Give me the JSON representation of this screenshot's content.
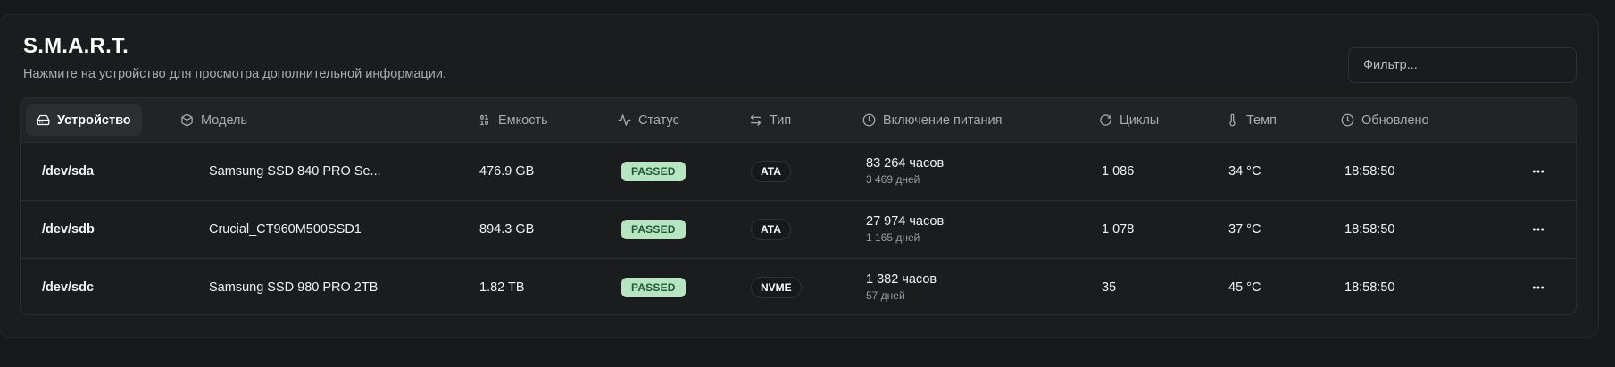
{
  "header": {
    "title": "S.M.A.R.T.",
    "subtitle": "Нажмите на устройство для просмотра дополнительной информации."
  },
  "filter": {
    "placeholder": "Фильтр...",
    "value": ""
  },
  "columns": {
    "device": {
      "label": "Устройство",
      "icon": "hard-drive-icon"
    },
    "model": {
      "label": "Модель",
      "icon": "box-icon"
    },
    "capacity": {
      "label": "Емкость",
      "icon": "binary-icon"
    },
    "status": {
      "label": "Статус",
      "icon": "activity-icon"
    },
    "type": {
      "label": "Тип",
      "icon": "arrows-left-right-icon"
    },
    "power_on": {
      "label": "Включение питания",
      "icon": "clock-icon"
    },
    "cycles": {
      "label": "Циклы",
      "icon": "refresh-icon"
    },
    "temp": {
      "label": "Темп",
      "icon": "thermometer-icon"
    },
    "updated": {
      "label": "Обновлено",
      "icon": "clock-icon"
    }
  },
  "rows": [
    {
      "device": "/dev/sda",
      "model": "Samsung SSD 840 PRO Se...",
      "capacity": "476.9 GB",
      "status": "PASSED",
      "type": "ATA",
      "power_hours": "83 264 часов",
      "power_days": "3 469 дней",
      "cycles": "1 086",
      "temp": "34 °C",
      "updated": "18:58:50"
    },
    {
      "device": "/dev/sdb",
      "model": "Crucial_CT960M500SSD1",
      "capacity": "894.3 GB",
      "status": "PASSED",
      "type": "ATA",
      "power_hours": "27 974 часов",
      "power_days": "1 165 дней",
      "cycles": "1 078",
      "temp": "37 °C",
      "updated": "18:58:50"
    },
    {
      "device": "/dev/sdc",
      "model": "Samsung SSD 980 PRO 2TB",
      "capacity": "1.82 TB",
      "status": "PASSED",
      "type": "NVME",
      "power_hours": "1 382 часов",
      "power_days": "57 дней",
      "cycles": "35",
      "temp": "45 °C",
      "updated": "18:58:50"
    }
  ],
  "row_actions_icon": "more-horizontal-icon",
  "colors": {
    "background": "#18191b",
    "card": "#1b1c1e",
    "header_row": "#222326",
    "passed_bg": "#b7e4c1",
    "passed_text": "#1d5a30"
  }
}
